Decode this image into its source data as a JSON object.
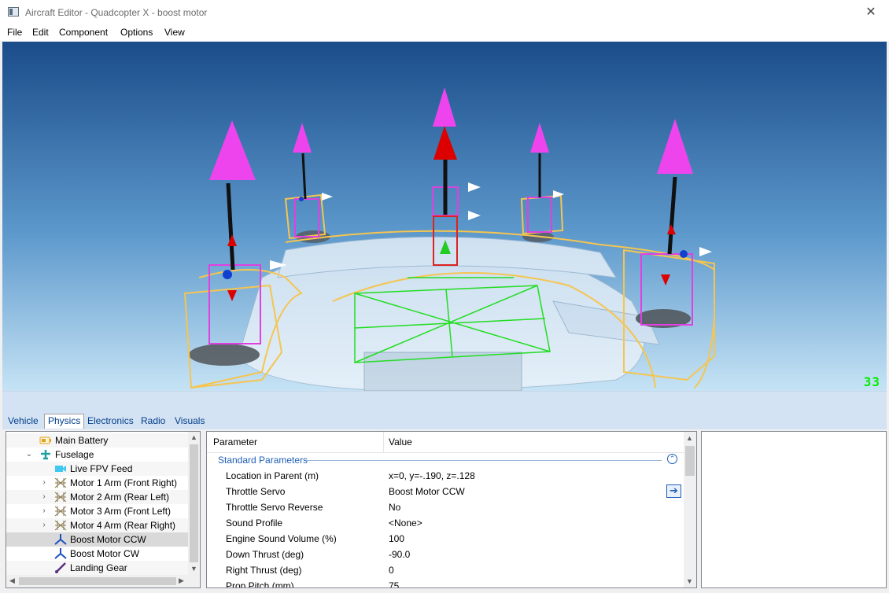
{
  "window": {
    "title": "Aircraft Editor - Quadcopter X - boost motor",
    "close_glyph": "✕"
  },
  "menu": [
    "File",
    "Edit",
    "Component",
    "Options",
    "View"
  ],
  "viewport": {
    "fps_counter": "33",
    "background_top": "#1a4c8a",
    "background_bottom": "#c6e3f5"
  },
  "tabs": [
    {
      "label": "Vehicle",
      "active": false
    },
    {
      "label": "Physics",
      "active": true
    },
    {
      "label": "Electronics",
      "active": false
    },
    {
      "label": "Radio",
      "active": false
    },
    {
      "label": "Visuals",
      "active": false
    }
  ],
  "tree": {
    "items": [
      {
        "label": "Main Battery",
        "icon": "battery-icon",
        "expander": ""
      },
      {
        "label": "Fuselage",
        "icon": "airplane-icon",
        "expander": "⌄"
      },
      {
        "label": "Live FPV Feed",
        "icon": "camera-icon",
        "expander": ""
      },
      {
        "label": "Motor 1 Arm (Front Right)",
        "icon": "truss-arm-icon",
        "expander": "›"
      },
      {
        "label": "Motor 2 Arm (Rear Left)",
        "icon": "truss-arm-icon",
        "expander": "›"
      },
      {
        "label": "Motor 3 Arm (Front Left)",
        "icon": "truss-arm-icon",
        "expander": "›"
      },
      {
        "label": "Motor 4 Arm (Rear Right)",
        "icon": "truss-arm-icon",
        "expander": "›"
      },
      {
        "label": "Boost Motor CCW",
        "icon": "propeller-icon",
        "expander": "",
        "selected": true
      },
      {
        "label": "Boost Motor CW",
        "icon": "propeller-icon",
        "expander": ""
      },
      {
        "label": "Landing Gear",
        "icon": "landing-gear-icon",
        "expander": ""
      }
    ]
  },
  "properties": {
    "col_parameter": "Parameter",
    "col_value": "Value",
    "section": "Standard Parameters",
    "collapse_glyph": "⌃",
    "goto_glyph": "➔",
    "rows": [
      {
        "name": "Location in Parent (m)",
        "value": "x=0, y=-.190, z=.128"
      },
      {
        "name": "Throttle Servo",
        "value": "Boost Motor CCW"
      },
      {
        "name": "Throttle Servo Reverse",
        "value": "No"
      },
      {
        "name": "Sound Profile",
        "value": "<None>"
      },
      {
        "name": "Engine Sound Volume (%)",
        "value": "100"
      },
      {
        "name": "Down Thrust (deg)",
        "value": "-90.0"
      },
      {
        "name": "Right Thrust (deg)",
        "value": "0"
      },
      {
        "name": "Prop Pitch (mm)",
        "value": "75"
      }
    ]
  },
  "scroll": {
    "up": "▲",
    "down": "▼",
    "left": "◀",
    "right": "▶"
  }
}
